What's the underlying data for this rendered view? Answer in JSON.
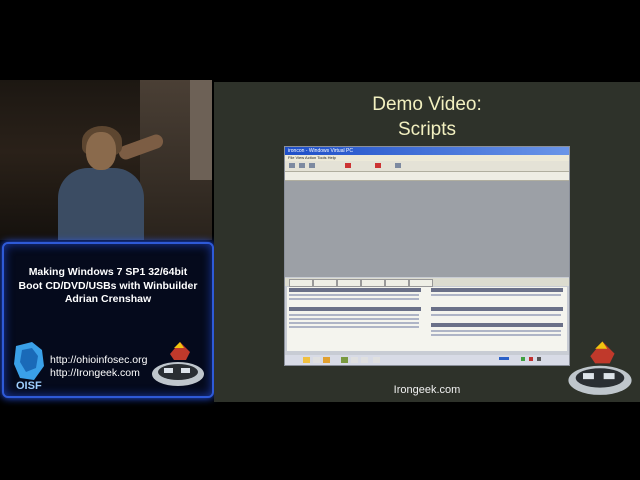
{
  "card": {
    "title_lines": [
      "Making Windows 7 SP1 32/64bit",
      "Boot CD/DVD/USBs with Winbuilder",
      "Adrian Crenshaw"
    ],
    "logo_text": "OISF",
    "links": [
      "http://ohioinfosec.org",
      "http://Irongeek.com"
    ]
  },
  "slide": {
    "title_lines": [
      "Demo Video:",
      "Scripts"
    ],
    "footer": "Irongeek.com"
  },
  "desktop": {
    "window_title": "ironcon - Windows Virtual PC",
    "menu": "File  View  Action  Tools  Help"
  },
  "colors": {
    "slide_bg": "#2e322a",
    "slide_title": "#f2f0c0",
    "card_border": "#2e5ad8",
    "card_bg": "#050a1c"
  },
  "icons": [
    "oisf-logo-icon",
    "irongeek-mascot-icon"
  ]
}
